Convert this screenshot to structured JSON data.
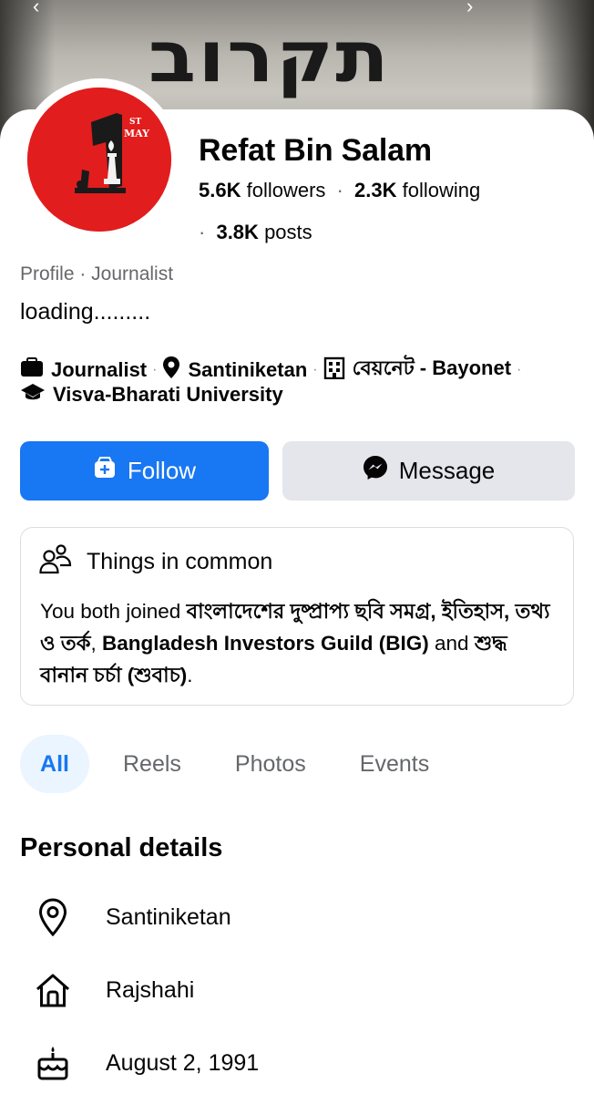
{
  "cover": {
    "graffiti_text": "תקרוב"
  },
  "avatar": {
    "badge_top": "ST",
    "badge_bottom": "MAY"
  },
  "profile": {
    "name": "Refat Bin Salam",
    "followers_count": "5.6K",
    "followers_label": "followers",
    "following_count": "2.3K",
    "following_label": "following",
    "posts_count": "3.8K",
    "posts_label": "posts",
    "category": "Profile · Journalist",
    "bio": "loading........."
  },
  "meta": {
    "job": "Journalist",
    "location": "Santiniketan",
    "workplace": "বেয়নেট - Bayonet",
    "education": "Visva-Bharati University"
  },
  "actions": {
    "follow_label": "Follow",
    "message_label": "Message"
  },
  "things_in_common": {
    "title": "Things in common",
    "prefix": "You both joined ",
    "group1": "বাংলাদেশের দুষ্প্রাপ্য ছবি সমগ্র, ইতিহাস, তথ্য ও তর্ক",
    "comma": ", ",
    "group2": "Bangladesh Investors Guild (BIG)",
    "and": " and ",
    "group3": "শুদ্ধ বানান চর্চা (শুবাচ)",
    "suffix": "."
  },
  "tabs": {
    "all": "All",
    "reels": "Reels",
    "photos": "Photos",
    "events": "Events"
  },
  "personal_details": {
    "title": "Personal details",
    "current_city": "Santiniketan",
    "hometown": "Rajshahi",
    "birthday": "August 2, 1991"
  },
  "colors": {
    "accent": "#1877f2",
    "avatar_bg": "#e21d1d",
    "secondary_button": "#e4e6eb",
    "muted_text": "#65676b"
  }
}
